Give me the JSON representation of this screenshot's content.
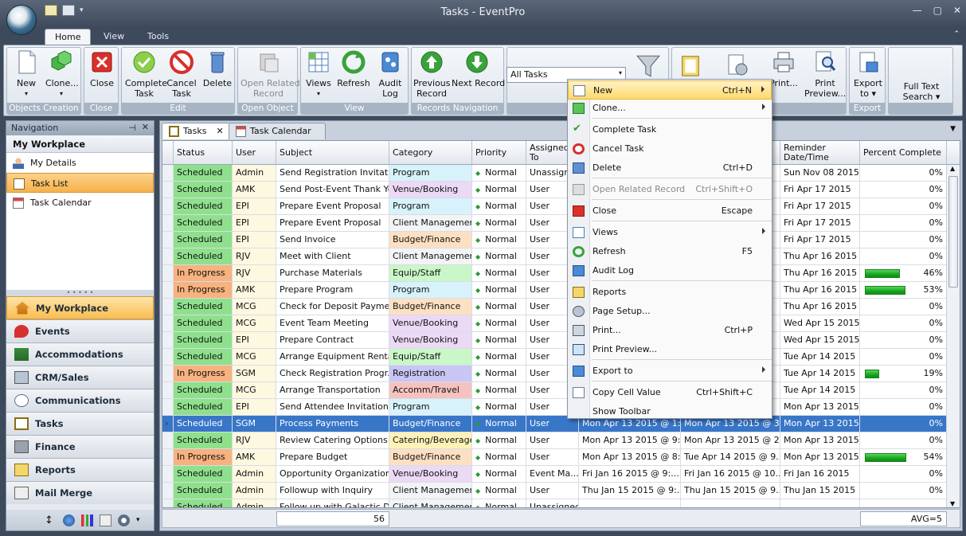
{
  "window": {
    "title": "Tasks - EventPro"
  },
  "ribbon_tabs": [
    "Home",
    "View",
    "Tools"
  ],
  "ribbon": {
    "groups": [
      {
        "caption": "Objects Creation",
        "buttons": [
          "New",
          "Clone..."
        ]
      },
      {
        "caption": "Close",
        "buttons": [
          "Close"
        ]
      },
      {
        "caption": "Edit",
        "buttons": [
          "Complete\nTask",
          "Cancel\nTask",
          "Delete"
        ]
      },
      {
        "caption": "Open Object",
        "buttons": [
          "Open Related\nRecord"
        ]
      },
      {
        "caption": "View",
        "buttons": [
          "Views",
          "Refresh",
          "Audit\nLog"
        ]
      },
      {
        "caption": "Records Navigation",
        "buttons": [
          "Previous\nRecord",
          "Next Record"
        ]
      },
      {
        "caption": "",
        "buttons": []
      },
      {
        "caption": "",
        "buttons": [
          "Print...",
          "Print\nPreview..."
        ]
      },
      {
        "caption": "Export",
        "buttons": [
          "Export\nto"
        ]
      },
      {
        "caption": "",
        "buttons": [
          "Full Text\nSearch"
        ]
      }
    ],
    "filter_value": "All Tasks"
  },
  "navigation": {
    "header": "Navigation",
    "workplace_title": "My Workplace",
    "items": [
      "My Details",
      "Task List",
      "Task Calendar"
    ],
    "modules": [
      "My Workplace",
      "Events",
      "Accommodations",
      "CRM/Sales",
      "Communications",
      "Tasks",
      "Finance",
      "Reports",
      "Mail Merge"
    ]
  },
  "doc_tabs": [
    "Tasks",
    "Task Calendar"
  ],
  "grid": {
    "columns": [
      "Status",
      "User",
      "Subject",
      "Category",
      "Priority",
      "Assigned To",
      "",
      "",
      "Reminder Date/Time",
      "Percent Complete"
    ],
    "rows": [
      {
        "status": "Scheduled",
        "user": "Admin",
        "subject": "Send Registration Invitation",
        "category": "Program",
        "priority": "Normal",
        "assigned": "Unassigned",
        "start": "",
        "due": "",
        "reminder": "Sun Nov 08 2015",
        "pct": "0%",
        "pct_value": 0
      },
      {
        "status": "Scheduled",
        "user": "AMK",
        "subject": "Send Post-Event Thank You",
        "category": "Venue/Booking",
        "priority": "Normal",
        "assigned": "User",
        "start": "",
        "due": "",
        "reminder": "Fri Apr 17 2015",
        "pct": "0%",
        "pct_value": 0
      },
      {
        "status": "Scheduled",
        "user": "EPI",
        "subject": "Prepare Event Proposal",
        "category": "Program",
        "priority": "Normal",
        "assigned": "User",
        "start": "",
        "due": "",
        "reminder": "Fri Apr 17 2015",
        "pct": "0%",
        "pct_value": 0
      },
      {
        "status": "Scheduled",
        "user": "EPI",
        "subject": "Prepare Event Proposal",
        "category": "Client Management",
        "priority": "Normal",
        "assigned": "User",
        "start": "",
        "due": "",
        "reminder": "Fri Apr 17 2015",
        "pct": "0%",
        "pct_value": 0
      },
      {
        "status": "Scheduled",
        "user": "EPI",
        "subject": "Send Invoice",
        "category": "Budget/Finance",
        "priority": "Normal",
        "assigned": "User",
        "start": "",
        "due": "",
        "reminder": "Fri Apr 17 2015",
        "pct": "0%",
        "pct_value": 0
      },
      {
        "status": "Scheduled",
        "user": "RJV",
        "subject": "Meet with Client",
        "category": "Client Management",
        "priority": "Normal",
        "assigned": "User",
        "start": "",
        "due": "",
        "reminder": "Thu Apr 16 2015",
        "pct": "0%",
        "pct_value": 0
      },
      {
        "status": "In Progress",
        "user": "RJV",
        "subject": "Purchase Materials",
        "category": "Equip/Staff",
        "priority": "Normal",
        "assigned": "User",
        "start": "",
        "due": "",
        "reminder": "Thu Apr 16 2015",
        "pct": "46%",
        "pct_value": 46
      },
      {
        "status": "In Progress",
        "user": "AMK",
        "subject": "Prepare Program",
        "category": "Program",
        "priority": "Normal",
        "assigned": "User",
        "start": "",
        "due": "",
        "reminder": "Thu Apr 16 2015",
        "pct": "53%",
        "pct_value": 53
      },
      {
        "status": "Scheduled",
        "user": "MCG",
        "subject": "Check for Deposit Payment",
        "category": "Budget/Finance",
        "priority": "Normal",
        "assigned": "User",
        "start": "",
        "due": "",
        "reminder": "Thu Apr 16 2015",
        "pct": "0%",
        "pct_value": 0
      },
      {
        "status": "Scheduled",
        "user": "MCG",
        "subject": "Event Team Meeting",
        "category": "Venue/Booking",
        "priority": "Normal",
        "assigned": "User",
        "start": "",
        "due": "",
        "reminder": "Wed Apr 15 2015",
        "pct": "0%",
        "pct_value": 0
      },
      {
        "status": "Scheduled",
        "user": "EPI",
        "subject": "Prepare Contract",
        "category": "Venue/Booking",
        "priority": "Normal",
        "assigned": "User",
        "start": "",
        "due": "",
        "reminder": "Wed Apr 15 2015",
        "pct": "0%",
        "pct_value": 0
      },
      {
        "status": "Scheduled",
        "user": "MCG",
        "subject": "Arrange Equipment Rental",
        "category": "Equip/Staff",
        "priority": "Normal",
        "assigned": "User",
        "start": "",
        "due": "",
        "reminder": "Tue Apr 14 2015",
        "pct": "0%",
        "pct_value": 0
      },
      {
        "status": "In Progress",
        "user": "SGM",
        "subject": "Check Registration Progr...",
        "category": "Registration",
        "priority": "Normal",
        "assigned": "User",
        "start": "",
        "due": "",
        "reminder": "Tue Apr 14 2015",
        "pct": "19%",
        "pct_value": 19
      },
      {
        "status": "Scheduled",
        "user": "MCG",
        "subject": "Arrange Transportation",
        "category": "Accomm/Travel",
        "priority": "Normal",
        "assigned": "User",
        "start": "",
        "due": "",
        "reminder": "Tue Apr 14 2015",
        "pct": "0%",
        "pct_value": 0
      },
      {
        "status": "Scheduled",
        "user": "EPI",
        "subject": "Send Attendee Invitations",
        "category": "Program",
        "priority": "Normal",
        "assigned": "User",
        "start": "",
        "due": "",
        "reminder": "Mon Apr 13 2015",
        "pct": "0%",
        "pct_value": 0
      },
      {
        "status": "Scheduled",
        "user": "SGM",
        "subject": "Process Payments",
        "category": "Budget/Finance",
        "priority": "Normal",
        "assigned": "User",
        "start": "Mon Apr 13 2015 @ 1:...",
        "due": "Mon Apr 13 2015 @ 3...",
        "reminder": "Mon Apr 13 2015",
        "pct": "0%",
        "pct_value": 0,
        "selected": true
      },
      {
        "status": "Scheduled",
        "user": "RJV",
        "subject": "Review Catering Options",
        "category": "Catering/Beverages",
        "priority": "Normal",
        "assigned": "User",
        "start": "Mon Apr 13 2015 @ 9:...",
        "due": "Mon Apr 13 2015 @ 2...",
        "reminder": "Mon Apr 13 2015",
        "pct": "0%",
        "pct_value": 0
      },
      {
        "status": "In Progress",
        "user": "AMK",
        "subject": "Prepare Budget",
        "category": "Budget/Finance",
        "priority": "Normal",
        "assigned": "User",
        "start": "Mon Apr 13 2015 @ 8:...",
        "due": "Tue Apr 14 2015 @ 9...",
        "reminder": "Mon Apr 13 2015",
        "pct": "54%",
        "pct_value": 54
      },
      {
        "status": "Scheduled",
        "user": "Admin",
        "subject": "Opportunity Organization...",
        "category": "Venue/Booking",
        "priority": "Normal",
        "assigned": "Event Ma...",
        "start": "Fri Jan 16 2015 @ 9:...",
        "due": "Fri Jan 16 2015 @ 10...",
        "reminder": "Fri Jan 16 2015",
        "pct": "0%",
        "pct_value": 0
      },
      {
        "status": "Scheduled",
        "user": "Admin",
        "subject": "Followup with Inquiry",
        "category": "Client Management",
        "priority": "Normal",
        "assigned": "User",
        "start": "Thu Jan 15 2015 @ 9:...",
        "due": "Thu Jan 15 2015 @ 9...",
        "reminder": "Thu Jan 15 2015",
        "pct": "0%",
        "pct_value": 0
      },
      {
        "status": "Scheduled",
        "user": "Admin",
        "subject": "Follow up with Galactic D...",
        "category": "Client Management",
        "priority": "Normal",
        "assigned": "Unassigned",
        "start": "",
        "due": "",
        "reminder": "",
        "pct": "",
        "pct_value": 0
      }
    ],
    "footer_count": "56",
    "footer_avg": "AVG=5"
  },
  "context_menu": {
    "items": [
      {
        "label": "New",
        "shortcut": "Ctrl+N",
        "submenu": true,
        "highlighted": true,
        "icon": "new-icon"
      },
      {
        "label": "Clone...",
        "shortcut": "",
        "submenu": true,
        "icon": "clone-icon"
      },
      {
        "label": "Complete Task",
        "shortcut": "",
        "icon": "check-icon"
      },
      {
        "label": "Cancel Task",
        "shortcut": "",
        "icon": "cancel-icon"
      },
      {
        "label": "Delete",
        "shortcut": "Ctrl+D",
        "icon": "delete-icon"
      },
      {
        "label": "Open Related Record",
        "shortcut": "Ctrl+Shift+O",
        "disabled": true,
        "icon": "open-related-icon"
      },
      {
        "label": "Close",
        "shortcut": "Escape",
        "icon": "close-icon"
      },
      {
        "label": "Views",
        "shortcut": "",
        "submenu": true,
        "icon": "views-icon"
      },
      {
        "label": "Refresh",
        "shortcut": "F5",
        "icon": "refresh-icon"
      },
      {
        "label": "Audit Log",
        "shortcut": "",
        "icon": "audit-log-icon"
      },
      {
        "label": "Reports",
        "shortcut": "",
        "icon": "reports-icon"
      },
      {
        "label": "Page Setup...",
        "shortcut": "",
        "icon": "page-setup-icon"
      },
      {
        "label": "Print...",
        "shortcut": "Ctrl+P",
        "icon": "print-icon"
      },
      {
        "label": "Print Preview...",
        "shortcut": "",
        "icon": "print-preview-icon"
      },
      {
        "label": "Export to",
        "shortcut": "",
        "submenu": true,
        "icon": "export-icon"
      },
      {
        "label": "Copy Cell Value",
        "shortcut": "Ctrl+Shift+C",
        "icon": "copy-icon"
      },
      {
        "label": "Show Toolbar",
        "shortcut": "",
        "icon": ""
      }
    ]
  },
  "colors": {
    "scheduled": "#8fe08d",
    "in_progress": "#f7b27f",
    "selection": "#3876c8",
    "menu_highlight": "#ffd96b",
    "nav_selected": "#f6b24a"
  }
}
